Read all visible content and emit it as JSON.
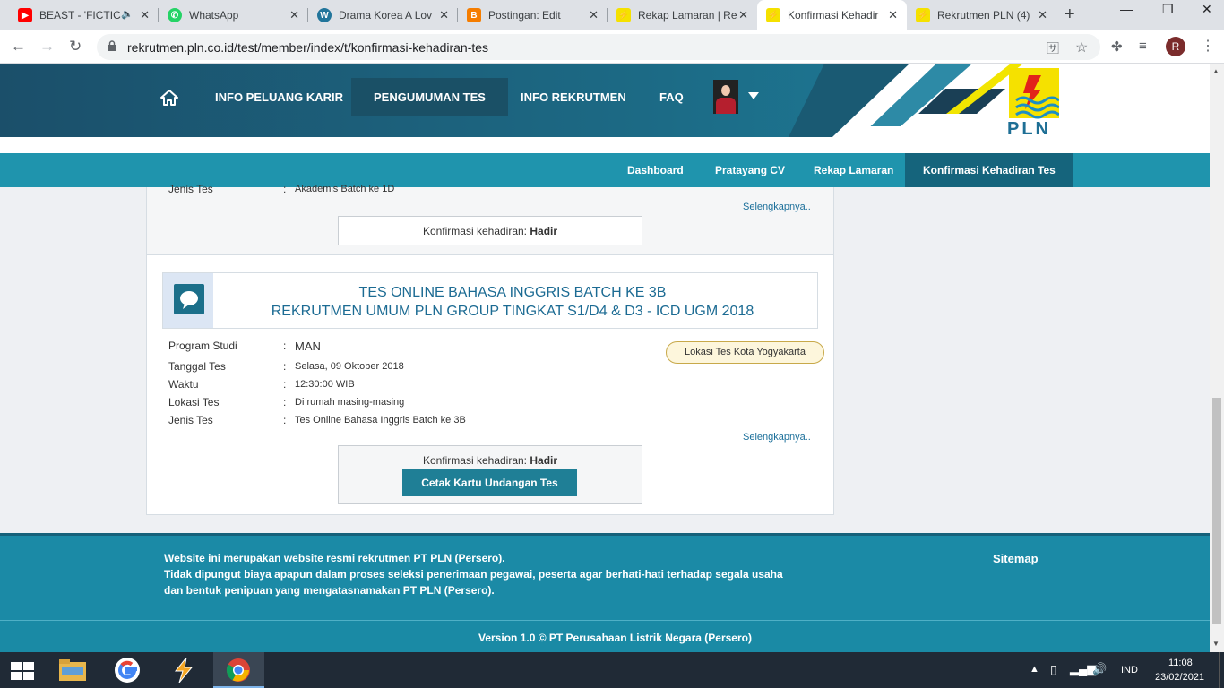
{
  "browser": {
    "tabs": [
      {
        "title": "BEAST - 'FICTIC",
        "icon": "youtube-icon"
      },
      {
        "title": "WhatsApp",
        "icon": "whatsapp-icon"
      },
      {
        "title": "Drama Korea A Lov",
        "icon": "wordpress-icon"
      },
      {
        "title": "Postingan: Edit",
        "icon": "blogger-icon"
      },
      {
        "title": "Rekap Lamaran | Re",
        "icon": "pln-icon"
      },
      {
        "title": "Konfirmasi Kehadir",
        "icon": "pln-icon"
      },
      {
        "title": "Rekrutmen PLN (4)",
        "icon": "pln-icon"
      }
    ],
    "active_tab": 5,
    "url": "rekrutmen.pln.co.id/test/member/index/t/konfirmasi-kehadiran-tes",
    "profile_initial": "R"
  },
  "header": {
    "nav": [
      "INFO PELUANG KARIR",
      "PENGUMUMAN TES",
      "INFO REKRUTMEN",
      "FAQ"
    ],
    "logo_text": "PLN"
  },
  "subnav": [
    "Dashboard",
    "Pratayang CV",
    "Rekap Lamaran",
    "Konfirmasi Kehadiran Tes"
  ],
  "card1": {
    "label": "Jenis Tes",
    "value": "Akademis Batch ke 1D",
    "more": "Selengkapnya..",
    "confirm_label": "Konfirmasi kehadiran:",
    "confirm_value": "Hadir"
  },
  "card2": {
    "title_line1": "TES ONLINE BAHASA INGGRIS BATCH KE 3B",
    "title_line2": "REKRUTMEN UMUM PLN GROUP TINGKAT S1/D4 & D3 - ICD UGM 2018",
    "fields": [
      {
        "label": "Program Studi",
        "value": "MAN"
      },
      {
        "label": "Tanggal Tes",
        "value": "Selasa, 09 Oktober 2018"
      },
      {
        "label": "Waktu",
        "value": "12:30:00 WIB"
      },
      {
        "label": "Lokasi Tes",
        "value": "Di rumah masing-masing"
      },
      {
        "label": "Jenis Tes",
        "value": "Tes Online Bahasa Inggris Batch ke 3B"
      }
    ],
    "location_badge": "Lokasi Tes Kota Yogyakarta",
    "more": "Selengkapnya..",
    "confirm_label": "Konfirmasi kehadiran:",
    "confirm_value": "Hadir",
    "print_button": "Cetak Kartu Undangan Tes"
  },
  "footer": {
    "line1": "Website ini merupakan website resmi rekrutmen PT PLN (Persero).",
    "line2": "Tidak dipungut biaya apapun dalam proses seleksi penerimaan pegawai, peserta agar berhati-hati terhadap segala usaha",
    "line3": "dan bentuk penipuan yang mengatasnamakan PT PLN (Persero).",
    "sitemap": "Sitemap",
    "version": "Version 1.0 © PT Perusahaan Listrik Negara (Persero)"
  },
  "taskbar": {
    "lang": "IND",
    "time": "11:08",
    "date": "23/02/2021"
  }
}
